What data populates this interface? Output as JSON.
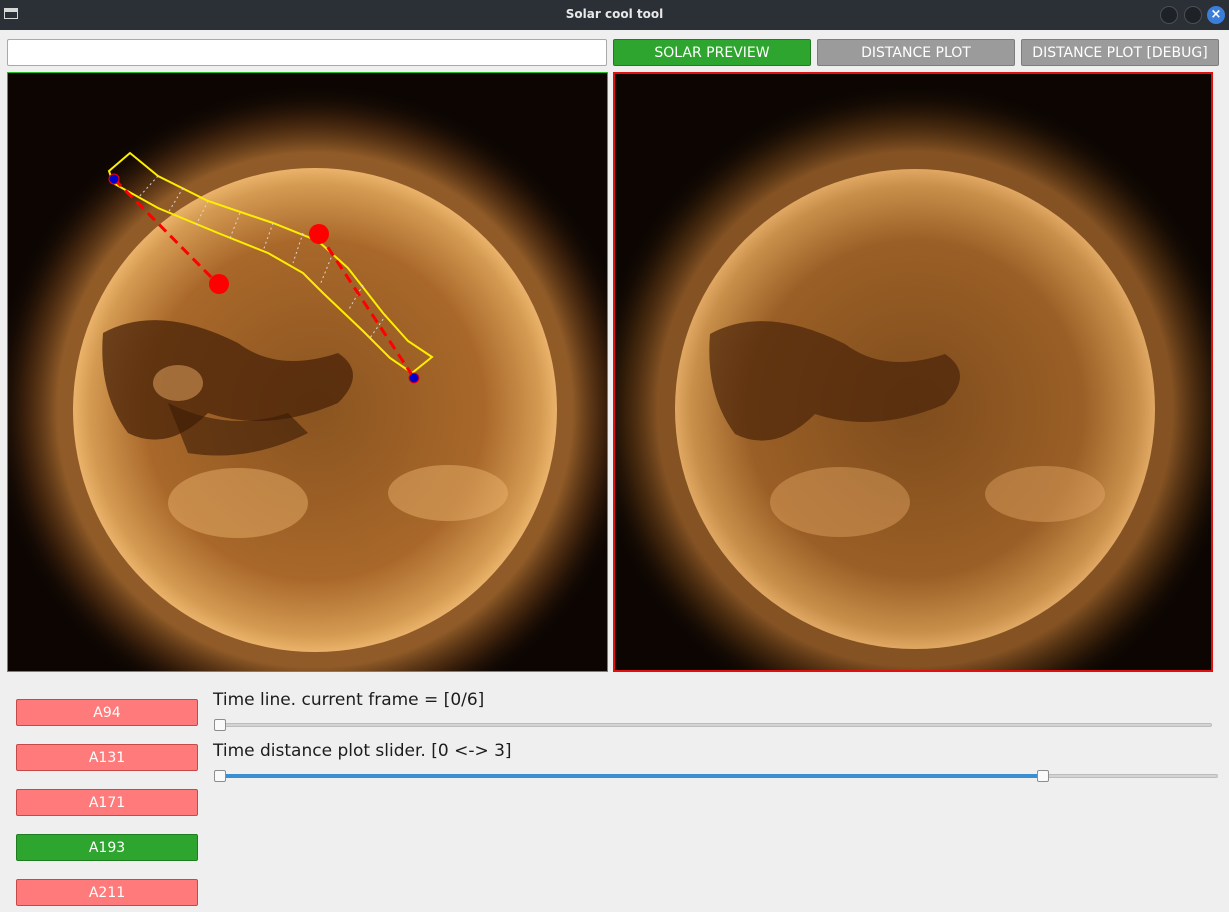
{
  "window": {
    "title": "Solar cool tool",
    "close_glyph": "×"
  },
  "toolbar": {
    "path_value": "",
    "solar_preview_label": "SOLAR PREVIEW",
    "distance_plot_label": "DISTANCE PLOT",
    "distance_plot_debug_label": "DISTANCE PLOT [DEBUG]"
  },
  "filters": {
    "items": [
      "A94",
      "A131",
      "A171",
      "A193",
      "A211"
    ],
    "selected": "A193"
  },
  "timeline": {
    "label": "Time line. current frame = [0/6]",
    "current": 0,
    "max": 6
  },
  "distance_slider": {
    "label": "Time distance plot slider. [0 <-> 3]",
    "low": 0,
    "high": 3,
    "handle_positions_fraction": [
      0.0,
      0.83
    ]
  },
  "colors": {
    "active_green": "#2ea52e",
    "inactive_red": "#ff7b7b",
    "inactive_gray": "#9b9b9b",
    "left_panel_border": "#22bb22",
    "right_panel_border": "#e01010",
    "path_yellow": "#ffee00",
    "control_red": "#ff0000",
    "endpoint_blue": "#0000cc",
    "slider_fill": "#3a8fd0"
  },
  "icons": {
    "window_app": "app-window-icon",
    "minimize": "minimize-icon",
    "maximize": "maximize-icon",
    "close": "close-icon"
  }
}
